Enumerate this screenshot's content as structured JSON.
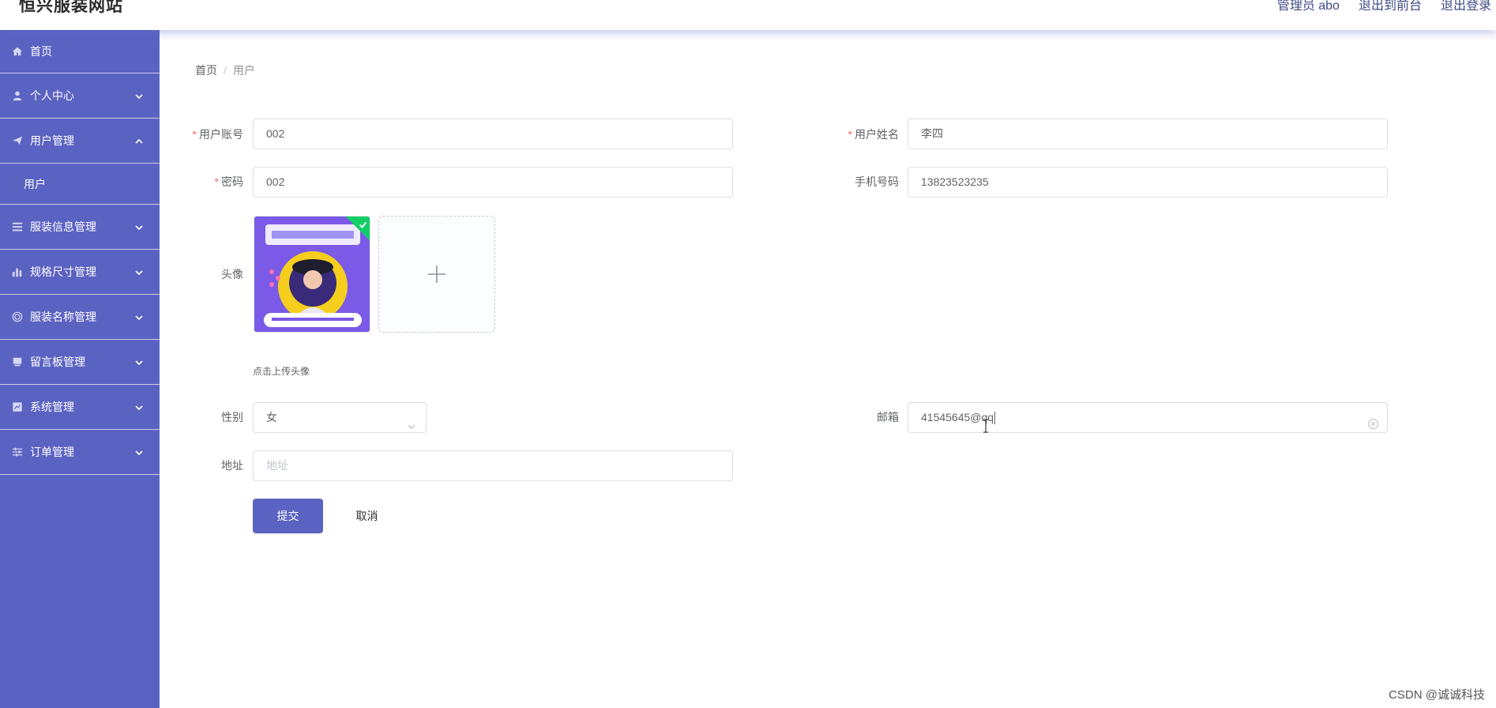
{
  "header": {
    "site_title": "恒兴服装网站",
    "admin_label": "管理员 abo",
    "back_to_front": "退出到前台",
    "logout": "退出登录"
  },
  "sidebar": {
    "items": [
      {
        "label": "首页",
        "icon": "home-icon"
      },
      {
        "label": "个人中心",
        "icon": "user-icon"
      },
      {
        "label": "用户管理",
        "icon": "send-icon",
        "expanded": true,
        "children": [
          {
            "label": "用户"
          }
        ]
      },
      {
        "label": "服装信息管理",
        "icon": "list-icon"
      },
      {
        "label": "规格尺寸管理",
        "icon": "bar-chart-icon"
      },
      {
        "label": "服装名称管理",
        "icon": "globe-icon"
      },
      {
        "label": "留言板管理",
        "icon": "board-icon"
      },
      {
        "label": "系统管理",
        "icon": "system-icon"
      },
      {
        "label": "订单管理",
        "icon": "sliders-icon"
      }
    ]
  },
  "breadcrumb": {
    "home": "首页",
    "sep": "/",
    "current": "用户"
  },
  "form": {
    "account_label": "用户账号",
    "account_value": "002",
    "name_label": "用户姓名",
    "name_value": "李四",
    "password_label": "密码",
    "password_value": "002",
    "phone_label": "手机号码",
    "phone_value": "13823523235",
    "avatar_label": "头像",
    "avatar_hint": "点击上传头像",
    "gender_label": "性别",
    "gender_value": "女",
    "email_label": "邮箱",
    "email_value": "41545645@qq",
    "address_label": "地址",
    "address_placeholder": "地址",
    "required_mark": "*"
  },
  "buttons": {
    "submit": "提交",
    "cancel": "取消"
  },
  "watermark": "CSDN @诚诚科技",
  "colors": {
    "primary": "#5b63c2",
    "required": "#f56c6c",
    "success_badge": "#13ce66"
  }
}
